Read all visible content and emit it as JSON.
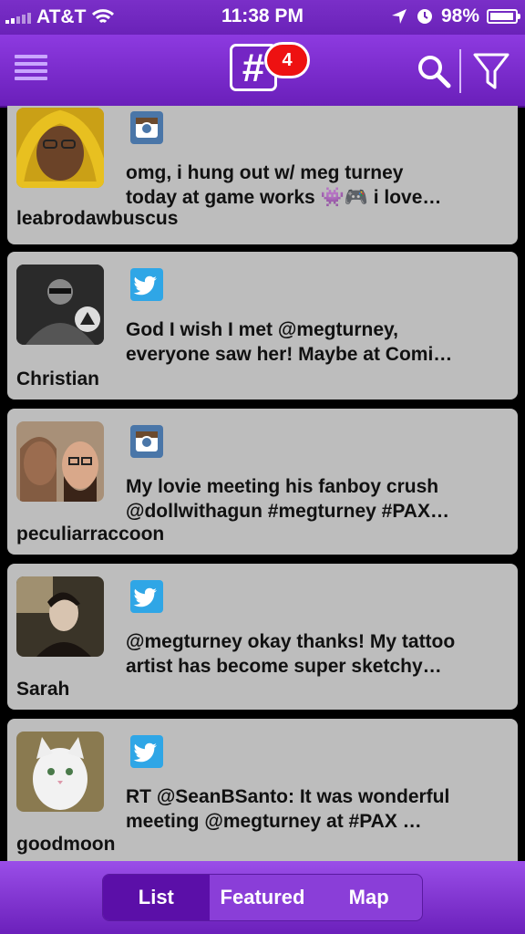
{
  "status_bar": {
    "carrier": "AT&T",
    "time": "11:38 PM",
    "battery": "98%",
    "battery_level": 0.98
  },
  "header": {
    "logo": "#",
    "notification_count": "4"
  },
  "posts": [
    {
      "source": "instagram",
      "line1": "omg, i hung out w/ meg turney",
      "line2": "today at game works 👾🎮 i love…",
      "user": "leabrodawbuscus"
    },
    {
      "source": "twitter",
      "line1": "God I wish I met @megturney,",
      "line2": "everyone saw her! Maybe at Comi…",
      "user": "Christian"
    },
    {
      "source": "instagram",
      "line1": "My lovie meeting his fanboy crush",
      "line2": "@dollwithagun #megturney #PAX…",
      "user": "peculiarraccoon"
    },
    {
      "source": "twitter",
      "line1": "@megturney okay thanks! My tattoo",
      "line2": "artist has become super sketchy…",
      "user": "Sarah"
    },
    {
      "source": "twitter",
      "line1": "RT @SeanBSanto: It was wonderful",
      "line2": "meeting @megturney at #PAX …",
      "user": "goodmoon"
    }
  ],
  "tabs": [
    {
      "label": "List",
      "active": true
    },
    {
      "label": "Featured",
      "active": false
    },
    {
      "label": "Map",
      "active": false
    }
  ],
  "colors": {
    "accent": "#7a2fc8",
    "card": "#bdbdbd",
    "instagram": "#4a76a8",
    "twitter": "#2fa6e6",
    "badge": "#ee1111"
  }
}
